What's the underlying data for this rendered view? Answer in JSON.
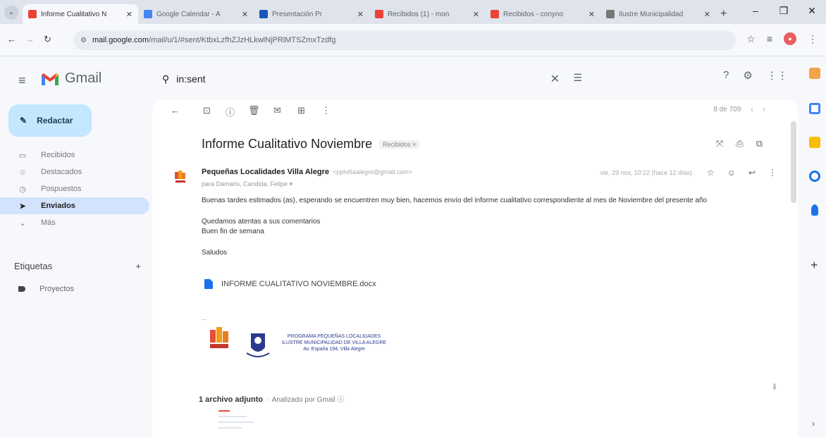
{
  "browser": {
    "tabs": [
      {
        "title": "Informe Cualitativo N",
        "active": true,
        "favicon_color": "#ea4335"
      },
      {
        "title": "Google Calendar - A",
        "active": false,
        "favicon_color": "#4285f4"
      },
      {
        "title": "Presentación Pr",
        "active": false,
        "favicon_color": "#1a56b8"
      },
      {
        "title": "Recibidos (1) - mon",
        "active": false,
        "favicon_color": "#ea4335"
      },
      {
        "title": "Recibidos - conyno",
        "active": false,
        "favicon_color": "#ea4335"
      },
      {
        "title": "Ilustre Municipalidad",
        "active": false,
        "favicon_color": "#777777"
      }
    ],
    "url_host": "mail.google.com",
    "url_path": "/mail/u/1/#sent/KtbxLzfhZJzHLkwlNjPRlMTSZmxTzdfg",
    "minimize": "–",
    "maximize": "❐",
    "close": "✕",
    "new_tab": "+"
  },
  "gmail": {
    "brand": "Gmail",
    "search_query": "in:sent",
    "compose_label": "Redactar",
    "nav": [
      {
        "label": "Recibidos",
        "icon": "inbox-icon",
        "glyph": "▭",
        "active": false
      },
      {
        "label": "Destacados",
        "icon": "star-icon",
        "glyph": "☆",
        "active": false
      },
      {
        "label": "Pospuestos",
        "icon": "clock-icon",
        "glyph": "◷",
        "active": false
      },
      {
        "label": "Enviados",
        "icon": "send-icon",
        "glyph": "➤",
        "active": true
      },
      {
        "label": "Más",
        "icon": "chevron-down-icon",
        "glyph": "⌄",
        "active": false
      }
    ],
    "labels_title": "Etiquetas",
    "labels_add": "+",
    "labels": [
      {
        "label": "Proyectos"
      }
    ],
    "pager": "8 de 709"
  },
  "message": {
    "subject": "Informe Cualitativo Noviembre",
    "folder_chip": "Recibidos ×",
    "sender_name": "Pequeñas Localidades Villa Alegre",
    "sender_email": "<pplvillaalegre@gmail.com>",
    "recipients": "para Damaris, Candida, Felipe",
    "date": "vie, 29 nov, 10:22 (hace 12 días)",
    "body": [
      "Buenas tardes estimados (as), esperando se encuentren muy bien, hacemos envío del informe cualitativo correspondiente al mes de Noviembre del presente año",
      "Quedamos atentas a sus comentarios",
      "Buen fin de semana",
      "Saludos"
    ],
    "attachment_link": "INFORME CUALITATIVO NOVIEMBRE.docx",
    "signature_sep": "--",
    "signature_lines": [
      "PROGRAMA PEQUEÑAS LOCALIDADES",
      "ILUSTRE MUNICIPALIDAD DE VILLA ALEGRE",
      "Av. España 194, Villa Alegre"
    ],
    "attachments_heading": "1 archivo adjunto",
    "attachments_scanned": "· Analizado por Gmail ⓘ"
  }
}
